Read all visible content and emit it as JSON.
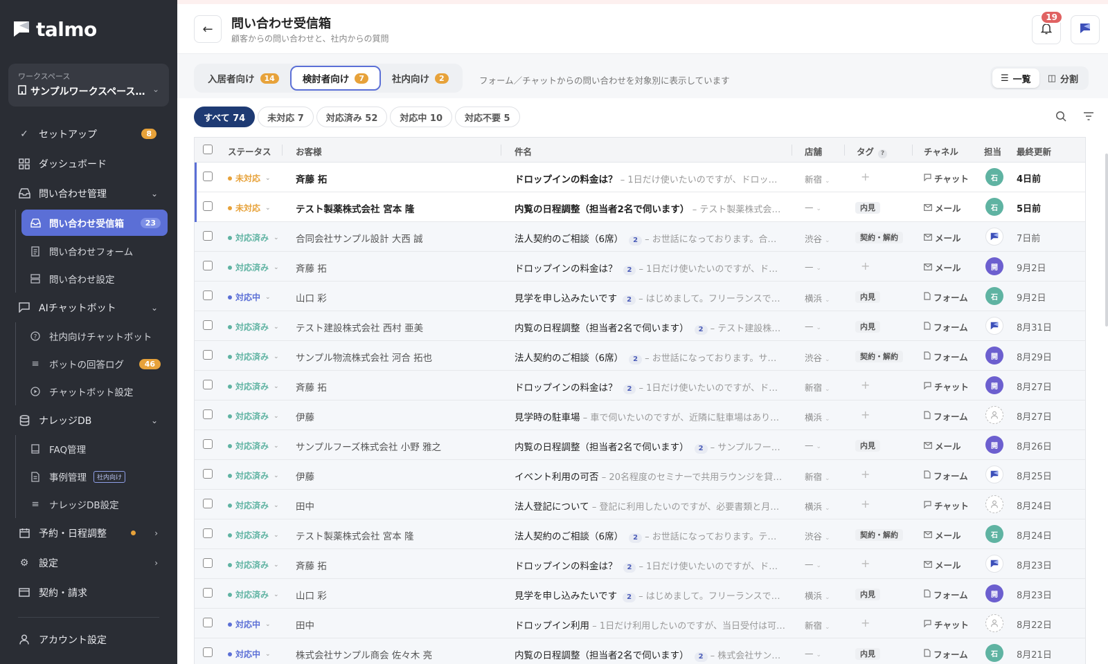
{
  "app": {
    "name": "talmo"
  },
  "colors": {
    "accent": "#5b6fd6",
    "orange": "#e7a23a",
    "sidebar_bg": "#2a2d34",
    "done": "#5fb3a2",
    "progress": "#5b6fd6"
  },
  "workspace": {
    "label": "ワークスペース",
    "name": "サンプルワークスペース…"
  },
  "nav": {
    "setup": {
      "label": "セットアップ",
      "badge": "8"
    },
    "dashboard": {
      "label": "ダッシュボード"
    },
    "inquiry": {
      "label": "問い合わせ管理",
      "items": [
        {
          "label": "問い合わせ受信箱",
          "badge": "23"
        },
        {
          "label": "問い合わせフォーム"
        },
        {
          "label": "問い合わせ設定"
        }
      ]
    },
    "ai": {
      "label": "AIチャットボット",
      "items": [
        {
          "label": "社内向けチャットボット"
        },
        {
          "label": "ボットの回答ログ",
          "badge": "46"
        },
        {
          "label": "チャットボット設定"
        }
      ]
    },
    "kdb": {
      "label": "ナレッジDB",
      "items": [
        {
          "label": "FAQ管理"
        },
        {
          "label": "事例管理",
          "tag": "社内向け"
        },
        {
          "label": "ナレッジDB設定"
        }
      ]
    },
    "booking": {
      "label": "予約・日程調整"
    },
    "settings": {
      "label": "設定"
    },
    "billing": {
      "label": "契約・請求"
    },
    "account": {
      "label": "アカウント設定"
    }
  },
  "header": {
    "title": "問い合わせ受信箱",
    "subtitle": "顧客からの問い合わせと、社内からの質問",
    "notifications": "19"
  },
  "segments": [
    {
      "label": "入居者向け",
      "count": "14"
    },
    {
      "label": "検討者向け",
      "count": "7"
    },
    {
      "label": "社内向け",
      "count": "2"
    }
  ],
  "segment_note": "フォーム／チャットからの問い合わせを対象別に表示しています",
  "view": {
    "list": "一覧",
    "split": "分割"
  },
  "filters": [
    "すべて 74",
    "未対応 7",
    "対応済み 52",
    "対応中 10",
    "対応不要 5"
  ],
  "columns": {
    "status": "ステータス",
    "customer": "お客様",
    "subject": "件名",
    "store": "店舗",
    "tag": "タグ",
    "channel": "チャネル",
    "assignee": "担当",
    "updated": "最終更新"
  },
  "rows": [
    {
      "status": "未対応",
      "customer": "斉藤 拓",
      "subject": "ドロップインの料金は？",
      "count": "",
      "preview": "– 1日だけ使いたいのですが、ドロッ…",
      "store": "新宿",
      "tag": "",
      "channel": "チャット",
      "assignee": "石",
      "updated": "4日前"
    },
    {
      "status": "未対応",
      "customer": "テスト製薬株式会社 宮本 隆",
      "subject": "内覧の日程調整（担当者2名で伺います）",
      "count": "",
      "preview": "– テスト製薬株式会…",
      "store": "—",
      "tag": "内見",
      "channel": "メール",
      "assignee": "石",
      "updated": "5日前"
    },
    {
      "status": "対応済み",
      "customer": "合同会社サンプル設計 大西 誠",
      "subject": "法人契約のご相談（6席）",
      "count": "2",
      "preview": "– お世話になっております。合…",
      "store": "渋谷",
      "tag": "契約・解約",
      "channel": "メール",
      "assignee": "",
      "updated": "7日前"
    },
    {
      "status": "対応済み",
      "customer": "斉藤 拓",
      "subject": "ドロップインの料金は？",
      "count": "2",
      "preview": "– 1日だけ使いたいのですが、ド…",
      "store": "—",
      "tag": "",
      "channel": "メール",
      "assignee": "開",
      "updated": "9月2日"
    },
    {
      "status": "対応中",
      "customer": "山口 彩",
      "subject": "見学を申し込みたいです",
      "count": "2",
      "preview": "– はじめまして。フリーランスで…",
      "store": "横浜",
      "tag": "内見",
      "channel": "フォーム",
      "assignee": "石",
      "updated": "9月2日"
    },
    {
      "status": "対応済み",
      "customer": "テスト建設株式会社 西村 亜美",
      "subject": "内覧の日程調整（担当者2名で伺います）",
      "count": "2",
      "preview": "– テスト建設株…",
      "store": "—",
      "tag": "内見",
      "channel": "フォーム",
      "assignee": "",
      "updated": "8月31日"
    },
    {
      "status": "対応済み",
      "customer": "サンプル物流株式会社 河合 拓也",
      "subject": "法人契約のご相談（6席）",
      "count": "2",
      "preview": "– お世話になっております。サ…",
      "store": "渋谷",
      "tag": "契約・解約",
      "channel": "フォーム",
      "assignee": "開",
      "updated": "8月29日"
    },
    {
      "status": "対応済み",
      "customer": "斉藤 拓",
      "subject": "ドロップインの料金は？",
      "count": "2",
      "preview": "– 1日だけ使いたいのですが、ド…",
      "store": "新宿",
      "tag": "",
      "channel": "チャット",
      "assignee": "開",
      "updated": "8月27日"
    },
    {
      "status": "対応済み",
      "customer": "伊藤",
      "subject": "見学時の駐車場",
      "count": "",
      "preview": "– 車で伺いたいのですが、近隣に駐車場はあり…",
      "store": "横浜",
      "tag": "",
      "channel": "フォーム",
      "assignee": "",
      "updated": "8月27日"
    },
    {
      "status": "対応済み",
      "customer": "サンプルフーズ株式会社 小野 雅之",
      "subject": "内覧の日程調整（担当者2名で伺います）",
      "count": "2",
      "preview": "– サンプルフー…",
      "store": "—",
      "tag": "内見",
      "channel": "メール",
      "assignee": "開",
      "updated": "8月26日"
    },
    {
      "status": "対応済み",
      "customer": "伊藤",
      "subject": "イベント利用の可否",
      "count": "",
      "preview": "– 20名程度のセミナーで共用ラウンジを貸…",
      "store": "新宿",
      "tag": "",
      "channel": "フォーム",
      "assignee": "",
      "updated": "8月25日"
    },
    {
      "status": "対応済み",
      "customer": "田中",
      "subject": "法人登記について",
      "count": "",
      "preview": "– 登記に利用したいのですが、必要書類と月…",
      "store": "横浜",
      "tag": "",
      "channel": "チャット",
      "assignee": "",
      "updated": "8月24日"
    },
    {
      "status": "対応済み",
      "customer": "テスト製薬株式会社 宮本 隆",
      "subject": "法人契約のご相談（6席）",
      "count": "2",
      "preview": "– お世話になっております。テ…",
      "store": "渋谷",
      "tag": "契約・解約",
      "channel": "メール",
      "assignee": "石",
      "updated": "8月24日"
    },
    {
      "status": "対応済み",
      "customer": "斉藤 拓",
      "subject": "ドロップインの料金は？",
      "count": "2",
      "preview": "– 1日だけ使いたいのですが、ド…",
      "store": "—",
      "tag": "",
      "channel": "メール",
      "assignee": "",
      "updated": "8月23日"
    },
    {
      "status": "対応済み",
      "customer": "山口 彩",
      "subject": "見学を申し込みたいです",
      "count": "2",
      "preview": "– はじめまして。フリーランスで…",
      "store": "横浜",
      "tag": "内見",
      "channel": "フォーム",
      "assignee": "開",
      "updated": "8月23日"
    },
    {
      "status": "対応中",
      "customer": "田中",
      "subject": "ドロップイン利用",
      "count": "",
      "preview": "– 1日だけ利用したいのですが、当日受付は可…",
      "store": "新宿",
      "tag": "",
      "channel": "チャット",
      "assignee": "",
      "updated": "8月22日"
    },
    {
      "status": "対応中",
      "customer": "株式会社サンプル商会 佐々木 亮",
      "subject": "内覧の日程調整（担当者2名で伺います）",
      "count": "2",
      "preview": "– 株式会社サン…",
      "store": "—",
      "tag": "内見",
      "channel": "フォーム",
      "assignee": "石",
      "updated": "8月21日"
    }
  ]
}
